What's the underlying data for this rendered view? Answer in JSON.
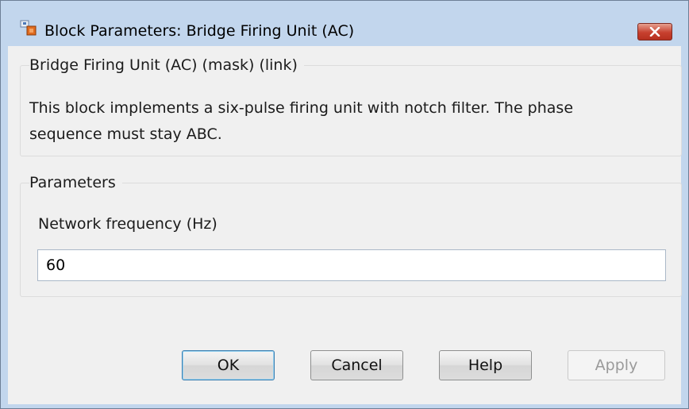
{
  "window": {
    "title": "Block Parameters: Bridge Firing Unit (AC)",
    "close_icon": "close-x-icon",
    "app_icon": "simulink-block-icon",
    "accent_close": "#c7402f"
  },
  "description_group": {
    "title": "Bridge Firing Unit (AC) (mask) (link)",
    "text": "This block implements a six-pulse firing unit with notch filter. The phase sequence must stay ABC."
  },
  "parameters_group": {
    "title": "Parameters",
    "frequency_label": "Network frequency (Hz)",
    "frequency_value": "60"
  },
  "buttons": {
    "ok": "OK",
    "cancel": "Cancel",
    "help": "Help",
    "apply": "Apply"
  }
}
